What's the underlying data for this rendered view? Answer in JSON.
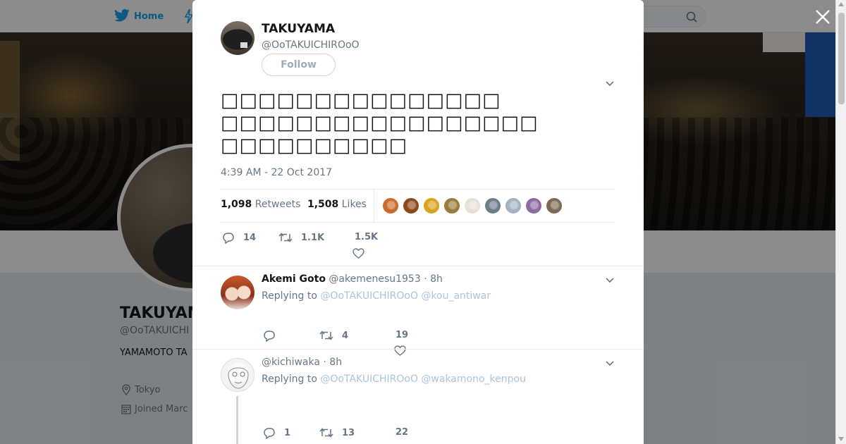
{
  "topnav": {
    "home_label": "Home"
  },
  "profile": {
    "name": "TAKUYAM",
    "handle": "@OoTAKUICHI",
    "bio": "YAMAMOTO TA",
    "location": "Tokyo",
    "joined": "Joined Marc"
  },
  "colors": {
    "accent": "#1da1f2",
    "text": "#14171a",
    "muted": "#657786",
    "border": "#e6ecf0"
  },
  "tweet": {
    "author_name": "TAKUYAMA",
    "author_handle": "@OoTAKUICHIROoO",
    "follow_label": "Follow",
    "text": "□□□□□□□□□□□□□□□\n□□□□□□□□□□□□□□□□□\n□□□□□□□□□□",
    "timestamp": "4:39 AM - 22 Oct 2017",
    "retweets_count": "1,098",
    "retweets_label": "Retweets",
    "likes_count": "1,508",
    "likes_label": "Likes",
    "liker_colors": [
      "#c96b2a",
      "#8a4a1c",
      "#d9a21b",
      "#9a7b3c",
      "#e8e1d6",
      "#6e7d8c",
      "#a3b3c2",
      "#8e6aa0",
      "#7d6a52"
    ],
    "reply_count": "14",
    "retweet_short": "1.1K",
    "like_short": "1.5K"
  },
  "replies": [
    {
      "name": "Akemi Goto",
      "handle": "@akemenesu1953",
      "time": "8h",
      "replying_prefix": "Replying to",
      "mentions": "@OoTAKUICHIROoO @kou_antiwar",
      "reply_count": "",
      "retweet_count": "4",
      "like_count": "19"
    },
    {
      "name": "",
      "handle": "@kichiwaka",
      "time": "8h",
      "replying_prefix": "Replying to",
      "mentions": "@OoTAKUICHIROoO @wakamono_kenpou",
      "reply_count": "1",
      "retweet_count": "13",
      "like_count": "22"
    }
  ]
}
